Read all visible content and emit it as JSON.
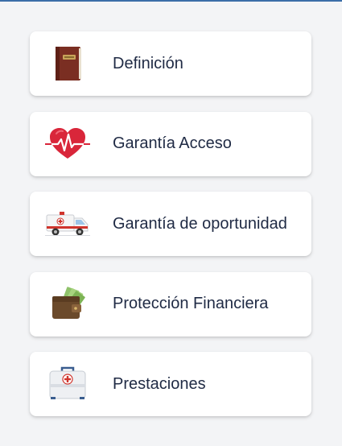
{
  "menu": {
    "items": [
      {
        "label": "Definición",
        "icon": "book-icon"
      },
      {
        "label": "Garantía Acceso",
        "icon": "heart-pulse-icon"
      },
      {
        "label": "Garantía de oportunidad",
        "icon": "ambulance-icon"
      },
      {
        "label": "Protección Financiera",
        "icon": "wallet-money-icon"
      },
      {
        "label": "Prestaciones",
        "icon": "first-aid-kit-icon"
      }
    ]
  },
  "colors": {
    "background": "#f3f4f6",
    "card": "#ffffff",
    "text": "#1f2a44",
    "top_line": "#3b6ea8"
  }
}
